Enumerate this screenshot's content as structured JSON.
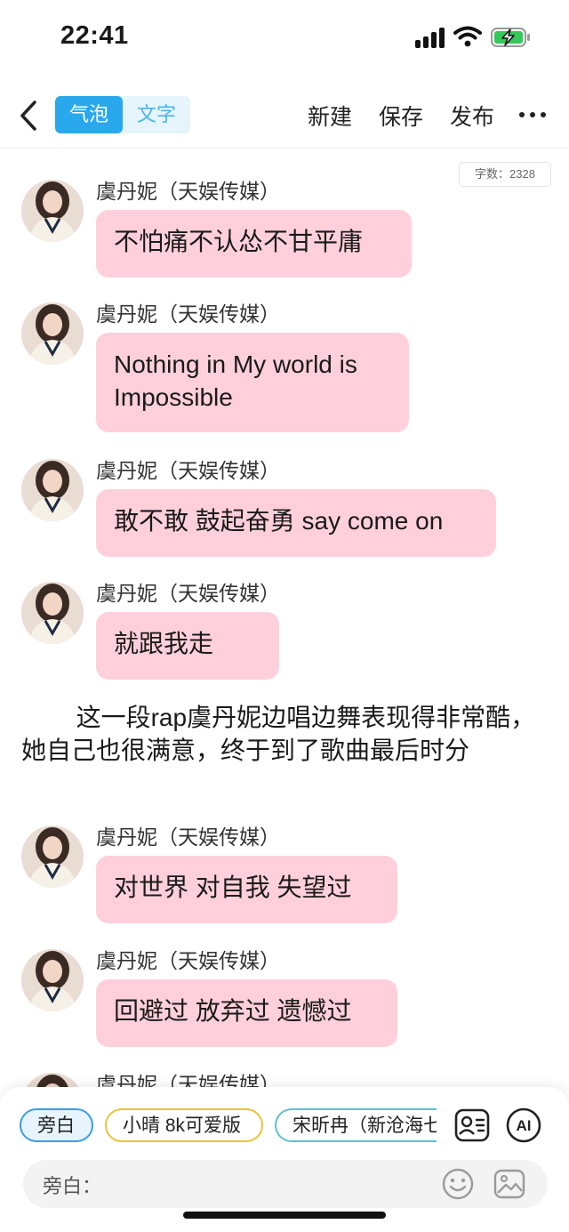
{
  "status_bar": {
    "time": "22:41"
  },
  "nav": {
    "segments": [
      "气泡",
      "文字"
    ],
    "actions": [
      "新建",
      "保存",
      "发布"
    ]
  },
  "word_count": "字数：2328",
  "messages": [
    {
      "sender": "虞丹妮（天娱传媒）",
      "text": "不怕痛不认怂不甘平庸"
    },
    {
      "sender": "虞丹妮（天娱传媒）",
      "text": "Nothing in My world is Impossible"
    },
    {
      "sender": "虞丹妮（天娱传媒）",
      "text": "敢不敢 鼓起奋勇 say come on"
    },
    {
      "sender": "虞丹妮（天娱传媒）",
      "text": "就跟我走"
    },
    {
      "sender": "虞丹妮（天娱传媒）",
      "text": "对世界 对自我 失望过"
    },
    {
      "sender": "虞丹妮（天娱传媒）",
      "text": "回避过 放弃过 遗憾过"
    },
    {
      "sender": "虞丹妮（天娱传媒）",
      "text": ""
    }
  ],
  "narration": "这一段rap虞丹妮边唱边舞表现得非常酷，她自己也很满意，终于到了歌曲最后时分",
  "bottom": {
    "roles": [
      "旁白",
      "小晴 8k可爱版",
      "宋昕冉（新沧海七"
    ],
    "ai_label": "AI",
    "input_label": "旁白："
  },
  "colors": {
    "accent": "#29a8ee",
    "bubble": "#ffd0dc",
    "chip_1_border": "#3a9ee6",
    "chip_2_border": "#e8c43a",
    "chip_3_border": "#5cc2cf"
  },
  "icons": [
    "back-arrow-icon",
    "more-icon",
    "contact-card-icon",
    "ai-icon",
    "emoji-icon",
    "image-icon",
    "signal-icon",
    "wifi-icon",
    "battery-charging-icon"
  ]
}
